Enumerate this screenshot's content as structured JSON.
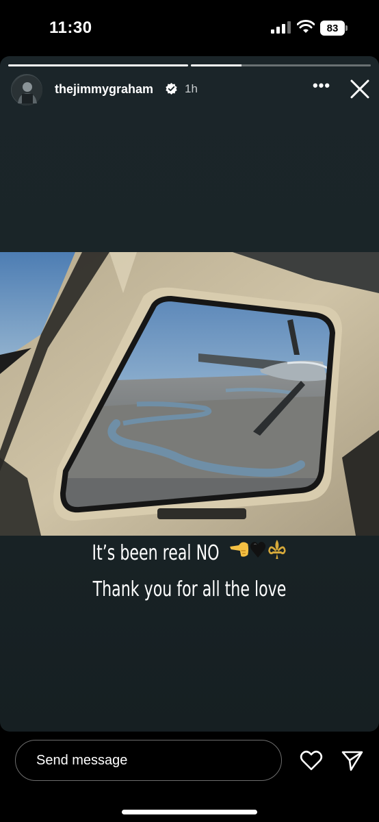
{
  "status_bar": {
    "time": "11:30",
    "battery_level": "83"
  },
  "story": {
    "progress_fraction": [
      1.0,
      0.28
    ],
    "username": "thejimmygraham",
    "time_ago": "1h",
    "more_label": "•••",
    "caption_line1": "It’s been real NO",
    "caption_line2": "Thank you for all the love",
    "emojis": [
      "hand-pointing-left",
      "black-heart",
      "fleur-de-lis"
    ]
  },
  "reply": {
    "placeholder": "Send message"
  },
  "colors": {
    "story_bg": "#1a2528",
    "verified_badge": "#ffffff"
  }
}
